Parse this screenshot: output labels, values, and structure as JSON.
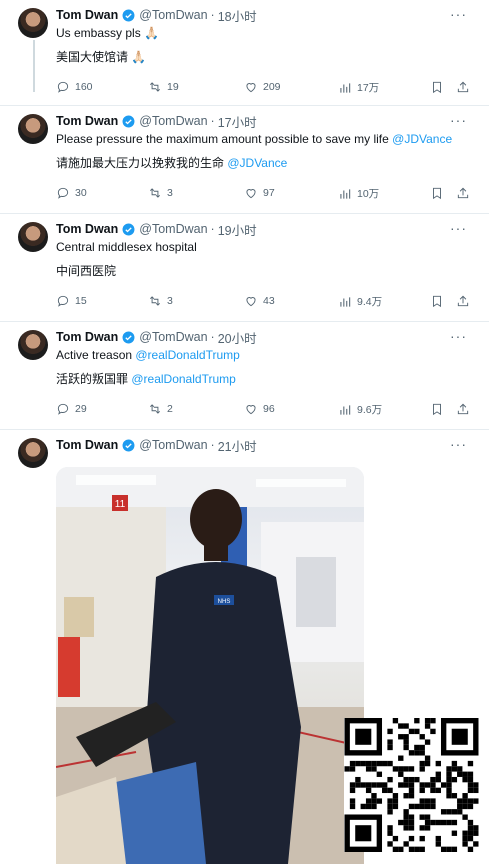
{
  "tweets": [
    {
      "name": "Tom Dwan",
      "handle": "@TomDwan",
      "time": "18小时",
      "line1": "Us embassy pls 🙏🏻",
      "line2": "美国大使馆请 🙏🏻",
      "mention1": "",
      "mention2": "",
      "stats": {
        "replies": "160",
        "retweets": "19",
        "likes": "209",
        "views": "17万"
      }
    },
    {
      "name": "Tom Dwan",
      "handle": "@TomDwan",
      "time": "17小时",
      "line1": "Please pressure the maximum amount possible to save my life ",
      "mention1": "@JDVance",
      "line2": "请施加最大压力以挽救我的生命 ",
      "mention2": "@JDVance",
      "stats": {
        "replies": "30",
        "retweets": "3",
        "likes": "97",
        "views": "10万"
      }
    },
    {
      "name": "Tom Dwan",
      "handle": "@TomDwan",
      "time": "19小时",
      "line1": "Central middlesex hospital",
      "line2": "中间西医院",
      "mention1": "",
      "mention2": "",
      "stats": {
        "replies": "15",
        "retweets": "3",
        "likes": "43",
        "views": "9.4万"
      }
    },
    {
      "name": "Tom Dwan",
      "handle": "@TomDwan",
      "time": "20小时",
      "line1": "Active treason ",
      "mention1": "@realDonaldTrump",
      "line2": "活跃的叛国罪 ",
      "mention2": "@realDonaldTrump",
      "stats": {
        "replies": "29",
        "retweets": "2",
        "likes": "96",
        "views": "9.6万"
      }
    },
    {
      "name": "Tom Dwan",
      "handle": "@TomDwan",
      "time": "21小时"
    }
  ],
  "media": {
    "room_sign": "11",
    "badge": "NHS"
  },
  "colors": {
    "accent": "#1d9bf0",
    "muted": "#536471"
  }
}
